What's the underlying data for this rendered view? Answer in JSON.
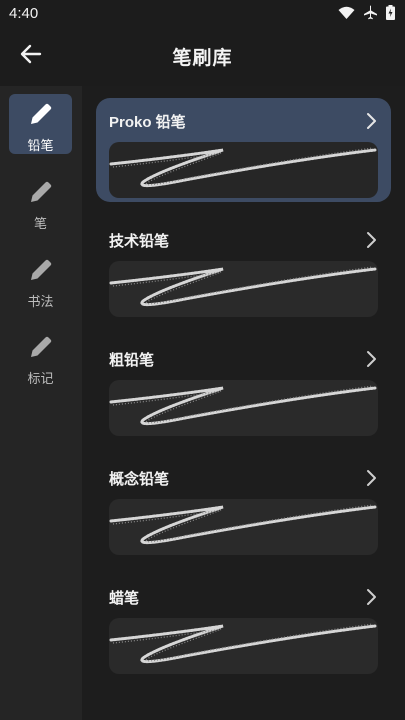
{
  "status_bar": {
    "time": "4:40",
    "icons": [
      "wifi-icon",
      "airplane-icon",
      "battery-charging-icon"
    ]
  },
  "header": {
    "title": "笔刷库",
    "back_icon": "arrow-left-icon"
  },
  "sidebar": {
    "items": [
      {
        "label": "铅笔",
        "icon": "pencil-icon",
        "active": true
      },
      {
        "label": "笔",
        "icon": "pencil-icon",
        "active": false
      },
      {
        "label": "书法",
        "icon": "pencil-icon",
        "active": false
      },
      {
        "label": "标记",
        "icon": "pencil-icon",
        "active": false
      }
    ]
  },
  "brushes": [
    {
      "name": "Proko 铅笔",
      "selected": true
    },
    {
      "name": "技术铅笔",
      "selected": false
    },
    {
      "name": "粗铅笔",
      "selected": false
    },
    {
      "name": "概念铅笔",
      "selected": false
    },
    {
      "name": "蜡笔",
      "selected": false
    }
  ],
  "colors": {
    "background": "#1c1c1c",
    "sidebar": "#252525",
    "selected": "#3d4b63",
    "preview": "#2a2a2a",
    "stroke": "#cfcfcf"
  }
}
